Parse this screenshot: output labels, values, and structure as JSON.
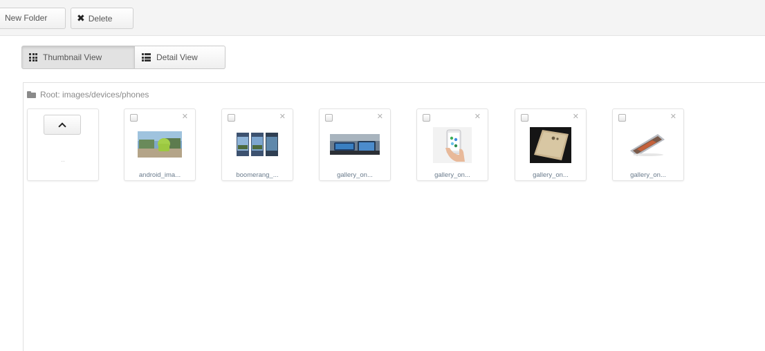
{
  "toolbar": {
    "new_folder_label": "New Folder",
    "delete_label": "Delete",
    "delete_glyph": "✖"
  },
  "views": {
    "thumbnail_label": "Thumbnail View",
    "detail_label": "Detail View",
    "active": "thumbnail"
  },
  "breadcrumb": {
    "text": "Root: images/devices/phones"
  },
  "up_tile": {
    "dots": ".."
  },
  "files": [
    {
      "name": "android_ima...",
      "checked": false,
      "thumb_desc": "green android figure in sunny plaza"
    },
    {
      "name": "boomerang_...",
      "checked": false,
      "thumb_desc": "three phone screens with city photo"
    },
    {
      "name": "gallery_on...",
      "checked": false,
      "thumb_desc": "blue phones on desk"
    },
    {
      "name": "gallery_on...",
      "checked": false,
      "thumb_desc": "hand holding phone"
    },
    {
      "name": "gallery_on...",
      "checked": false,
      "thumb_desc": "gold phone on dark background"
    },
    {
      "name": "gallery_on...",
      "checked": false,
      "thumb_desc": "phone lying diagonally"
    }
  ],
  "colors": {
    "toolbar_bg": "#f4f4f4",
    "active_view_bg": "#e2e2e2",
    "file_name": "#6a7b8c",
    "breadcrumb": "#8a8a8a"
  }
}
